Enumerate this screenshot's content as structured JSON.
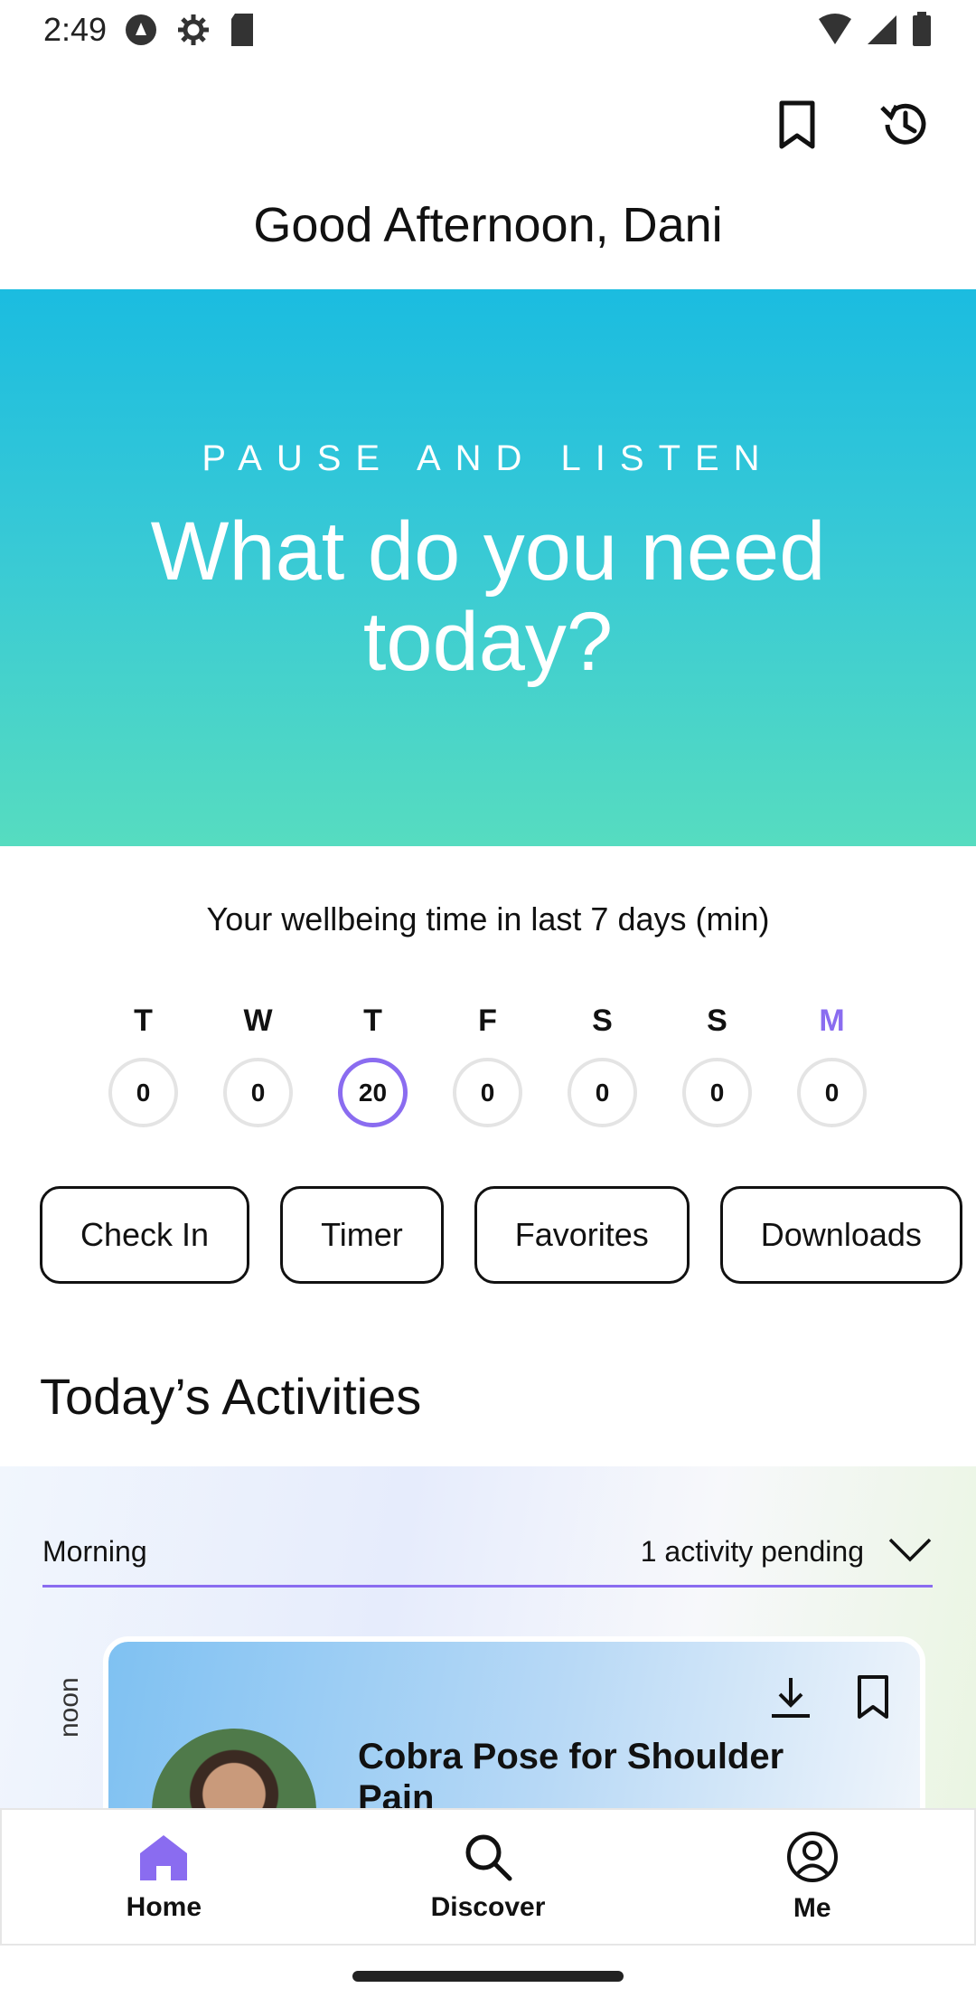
{
  "status_bar": {
    "time": "2:49",
    "left_icons": [
      "assistant-icon",
      "settings-icon",
      "sd-card-icon"
    ],
    "right_icons": [
      "wifi-icon",
      "cell-signal-icon",
      "battery-icon"
    ]
  },
  "header": {
    "bookmark_icon": "bookmark-icon",
    "history_icon": "history-icon",
    "greeting": "Good Afternoon, Dani"
  },
  "hero": {
    "kicker": "PAUSE AND LISTEN",
    "title": "What do you need today?",
    "colors": {
      "top": "#1bbce0",
      "bottom": "#56dcc0"
    }
  },
  "wellbeing": {
    "title": "Your wellbeing time in last 7 days (min)",
    "days": [
      {
        "letter": "T",
        "value": "0"
      },
      {
        "letter": "W",
        "value": "0"
      },
      {
        "letter": "T",
        "value": "20"
      },
      {
        "letter": "F",
        "value": "0"
      },
      {
        "letter": "S",
        "value": "0"
      },
      {
        "letter": "S",
        "value": "0"
      },
      {
        "letter": "M",
        "value": "0"
      }
    ],
    "accent": "#8a6cf0"
  },
  "chips": [
    "Check In",
    "Timer",
    "Favorites",
    "Downloads"
  ],
  "activities": {
    "title": "Today’s Activities",
    "period": "Morning",
    "status": "1 activity pending",
    "side_label": "noon",
    "card": {
      "title": "Cobra Pose for Shoulder Pain",
      "download_icon": "download-icon",
      "bookmark_icon": "bookmark-icon"
    }
  },
  "bottom_nav": [
    {
      "label": "Home",
      "icon": "home-icon"
    },
    {
      "label": "Discover",
      "icon": "search-icon"
    },
    {
      "label": "Me",
      "icon": "profile-icon"
    }
  ]
}
